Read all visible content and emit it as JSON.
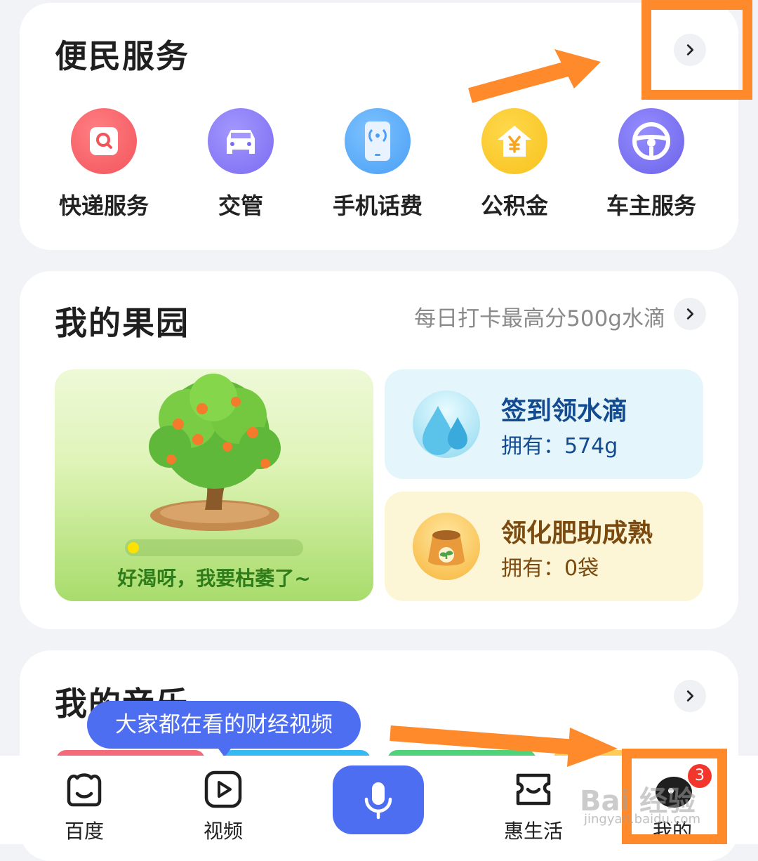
{
  "services": {
    "title": "便民服务",
    "items": [
      {
        "label": "快递服务",
        "icon": "package-search-icon",
        "color": "#f2545b"
      },
      {
        "label": "交管",
        "icon": "car-icon",
        "color": "#7c6cf0"
      },
      {
        "label": "手机话费",
        "icon": "phone-signal-icon",
        "color": "#4a9ff5"
      },
      {
        "label": "公积金",
        "icon": "house-yuan-icon",
        "color": "#f7c21c"
      },
      {
        "label": "车主服务",
        "icon": "steering-wheel-icon",
        "color": "#6c63e8"
      }
    ]
  },
  "garden": {
    "title": "我的果园",
    "subtitle": "每日打卡最高分500g水滴",
    "tree_status": "好渴呀，我要枯萎了~",
    "water_progress": 0.05,
    "checkin": {
      "title": "签到领水滴",
      "owned": "拥有：574g",
      "color": "#e4f5fc"
    },
    "fertilizer": {
      "title": "领化肥助成熟",
      "owned": "拥有：0袋",
      "color": "#fdf6d6"
    }
  },
  "music": {
    "title": "我的音乐"
  },
  "tooltip": {
    "text": "大家都在看的财经视频"
  },
  "tabbar": {
    "items": [
      {
        "label": "百度",
        "icon": "baidu-face-icon"
      },
      {
        "label": "视频",
        "icon": "video-play-icon"
      },
      {
        "label": "",
        "icon": "microphone-icon"
      },
      {
        "label": "惠生活",
        "icon": "shopping-icon"
      },
      {
        "label": "我的",
        "icon": "profile-icon"
      }
    ],
    "badge": "3"
  },
  "watermark": {
    "brand": "Bai 经验",
    "url": "jingyan.baidu.com"
  },
  "colors": {
    "accent": "#4e6ef2",
    "annotation": "#ff8a2b"
  }
}
